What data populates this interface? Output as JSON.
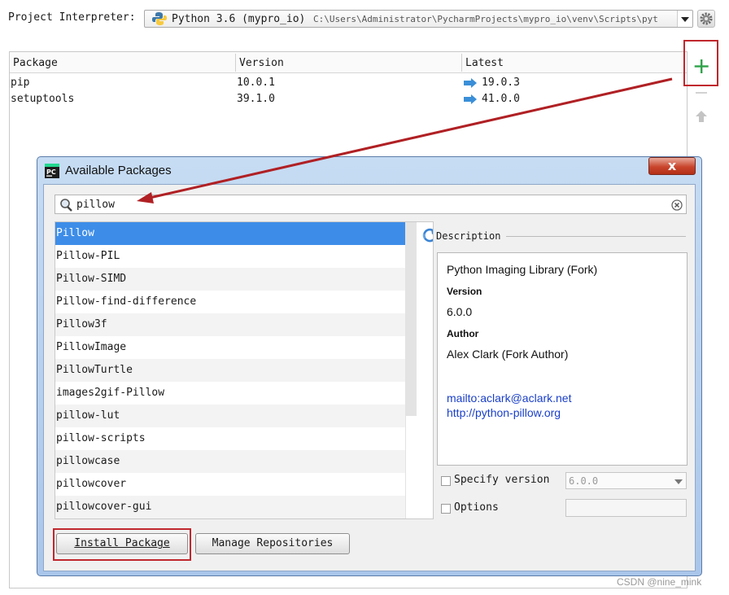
{
  "interpreter": {
    "label": "Project Interpreter:",
    "name": "Python 3.6 (mypro_io)",
    "path": "C:\\Users\\Administrator\\PycharmProjects\\mypro_io\\venv\\Scripts\\pyt"
  },
  "packages_table": {
    "columns": [
      "Package",
      "Version",
      "Latest"
    ],
    "rows": [
      {
        "package": "pip",
        "version": "10.0.1",
        "latest": "19.0.3"
      },
      {
        "package": "setuptools",
        "version": "39.1.0",
        "latest": "41.0.0"
      }
    ],
    "add_button": "+"
  },
  "dialog": {
    "title": "Available Packages",
    "close_label": "x",
    "search_value": "pillow",
    "results": [
      "Pillow",
      "Pillow-PIL",
      "Pillow-SIMD",
      "Pillow-find-difference",
      "Pillow3f",
      "PillowImage",
      "PillowTurtle",
      "images2gif-Pillow",
      "pillow-lut",
      "pillow-scripts",
      "pillowcase",
      "pillowcover",
      "pillowcover-gui"
    ],
    "selected_index": 0,
    "description": {
      "label": "Description",
      "summary": "Python Imaging Library (Fork)",
      "version_label": "Version",
      "version": "6.0.0",
      "author_label": "Author",
      "author": "Alex Clark (Fork Author)",
      "mailto": "mailto:aclark@aclark.net",
      "homepage": "http://python-pillow.org"
    },
    "specify_version_label": "Specify version",
    "specify_version_value": "6.0.0",
    "options_label": "Options",
    "install_button": "Install Package",
    "manage_button": "Manage Repositories"
  },
  "watermark": "CSDN @nine_mink",
  "colors": {
    "selection": "#3d8de8",
    "highlight_box": "#c0272d",
    "annotation_arrow": "#b02024",
    "link": "#1a3fc8",
    "add_icon": "#2fa34a"
  },
  "icons": [
    "python-icon",
    "gear-icon",
    "plus-icon",
    "minus-icon",
    "up-arrow-icon",
    "upgrade-arrow-icon",
    "pycharm-icon",
    "search-icon",
    "clear-icon",
    "refresh-icon"
  ]
}
